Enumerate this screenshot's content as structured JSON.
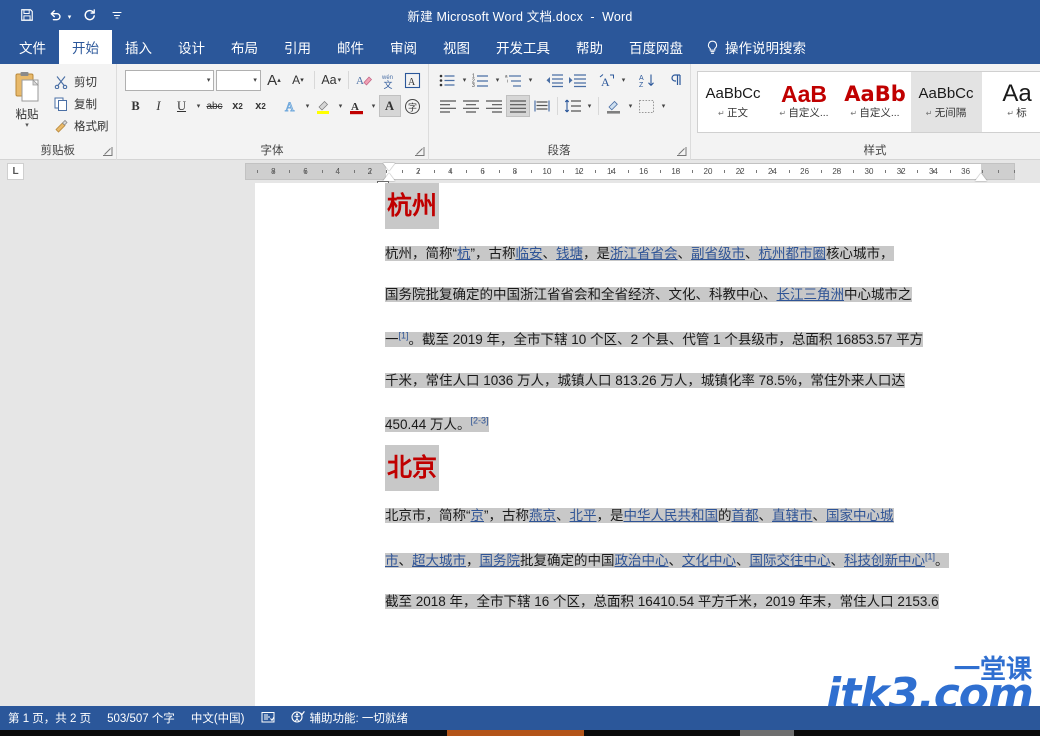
{
  "window": {
    "title": "新建 Microsoft Word 文档.docx  -  Word",
    "qat": [
      {
        "name": "save-icon",
        "label": "保存"
      },
      {
        "name": "undo-icon",
        "label": "撤消"
      },
      {
        "name": "redo-icon",
        "label": "恢复"
      },
      {
        "name": "customize-qat-icon",
        "label": "自定义快速访问工具栏"
      }
    ]
  },
  "tabs": [
    {
      "label": "文件",
      "active": false
    },
    {
      "label": "开始",
      "active": true
    },
    {
      "label": "插入",
      "active": false
    },
    {
      "label": "设计",
      "active": false
    },
    {
      "label": "布局",
      "active": false
    },
    {
      "label": "引用",
      "active": false
    },
    {
      "label": "邮件",
      "active": false
    },
    {
      "label": "审阅",
      "active": false
    },
    {
      "label": "视图",
      "active": false
    },
    {
      "label": "开发工具",
      "active": false
    },
    {
      "label": "帮助",
      "active": false
    },
    {
      "label": "百度网盘",
      "active": false
    }
  ],
  "tell_me": "操作说明搜索",
  "ribbon": {
    "clipboard": {
      "group_label": "剪贴板",
      "paste_label": "粘贴",
      "commands": [
        {
          "label": "剪切",
          "icon": "scissors-icon"
        },
        {
          "label": "复制",
          "icon": "copy-icon"
        },
        {
          "label": "格式刷",
          "icon": "format-painter-icon"
        }
      ]
    },
    "font": {
      "group_label": "字体",
      "font_name_value": "",
      "font_size_value": "",
      "row1": [
        "grow-font-icon",
        "shrink-font-icon",
        "change-case-icon",
        "clear-formatting-icon",
        "phonetic-guide-icon",
        "character-border-icon"
      ],
      "row2": [
        "bold-icon",
        "italic-icon",
        "underline-icon",
        "strikethrough-icon",
        "subscript-icon",
        "superscript-icon",
        "text-effects-icon",
        "text-highlight-icon",
        "font-color-icon",
        "character-shading-icon",
        "enclose-characters-icon"
      ],
      "labels": {
        "bold": "B",
        "italic": "I",
        "underline": "U",
        "strikethrough": "abc",
        "subscript": "x₂",
        "superscript": "x²",
        "change_case": "Aa",
        "grow": "A",
        "shrink": "A",
        "text_effects": "A",
        "font_color": "A",
        "shading": "A",
        "enclose": "字",
        "phonetic": "文"
      }
    },
    "paragraph": {
      "group_label": "段落",
      "row1": [
        "bullets-icon",
        "numbering-icon",
        "multilevel-list-icon",
        "decrease-indent-icon",
        "increase-indent-icon",
        "asian-layout-icon",
        "sort-icon",
        "show-marks-icon"
      ],
      "row2": [
        "align-left-icon",
        "align-center-icon",
        "align-right-icon",
        "justify-icon",
        "distributed-icon",
        "line-spacing-icon",
        "shading-icon",
        "borders-icon"
      ],
      "active_alignment": "justify-icon"
    },
    "styles": {
      "group_label": "样式",
      "items": [
        {
          "preview": "AaBbCc",
          "name": "正文",
          "color": "#1a1a1a",
          "size": "15px",
          "weight": "normal",
          "selected": false
        },
        {
          "preview": "AaB",
          "name": "自定义...",
          "color": "#c00000",
          "size": "23px",
          "weight": "bold",
          "selected": false
        },
        {
          "preview": "AaBb",
          "name": "自定义...",
          "color": "#c00000",
          "size": "21px",
          "weight": "bold",
          "selected": false
        },
        {
          "preview": "AaBbCc",
          "name": "无间隔",
          "color": "#1a1a1a",
          "size": "15px",
          "weight": "normal",
          "selected": true
        },
        {
          "preview": "Aa",
          "name": "标",
          "color": "#1a1a1a",
          "size": "24px",
          "weight": "normal",
          "selected": false
        }
      ]
    }
  },
  "ruler": {
    "tab_selector": "L",
    "left_ticks": [
      "8",
      "6",
      "4",
      "2"
    ],
    "ticks": [
      "2",
      "4",
      "6",
      "8",
      "10",
      "12",
      "14",
      "16",
      "18",
      "20",
      "22",
      "24",
      "26",
      "28",
      "30",
      "32",
      "34",
      "36"
    ]
  },
  "document": {
    "sections": [
      {
        "heading": "杭州",
        "lines": [
          [
            {
              "t": "杭州，简称“",
              "k": "p"
            },
            {
              "t": "杭",
              "k": "a"
            },
            {
              "t": "”，古称",
              "k": "p"
            },
            {
              "t": "临安",
              "k": "a"
            },
            {
              "t": "、",
              "k": "p"
            },
            {
              "t": "钱塘",
              "k": "a"
            },
            {
              "t": "，是",
              "k": "p"
            },
            {
              "t": "浙江省省会",
              "k": "a"
            },
            {
              "t": "、",
              "k": "p"
            },
            {
              "t": "副省级市",
              "k": "a"
            },
            {
              "t": "、",
              "k": "p"
            },
            {
              "t": "杭州都市圈",
              "k": "a"
            },
            {
              "t": "核心城市，",
              "k": "p"
            }
          ],
          [
            {
              "t": "国务院批复确定的中国浙江省省会和全省经济、文化、科教中心、",
              "k": "p"
            },
            {
              "t": "长江三角洲",
              "k": "a"
            },
            {
              "t": "中心城市之",
              "k": "p"
            }
          ],
          [
            {
              "t": "一",
              "k": "p"
            },
            {
              "t": "[1]",
              "k": "r"
            },
            {
              "t": "。截至 2019 年，全市下辖 10 个区、2 个县、代管 1 个县级市，总面积 16853.57 平方",
              "k": "p"
            }
          ],
          [
            {
              "t": "千米，常住人口 1036 万人，城镇人口 813.26 万人，城镇化率 78.5%，常住外来人口达",
              "k": "p"
            }
          ],
          [
            {
              "t": "450.44 万人。",
              "k": "p"
            },
            {
              "t": "[2-3]",
              "k": "r"
            }
          ]
        ]
      },
      {
        "heading": "北京",
        "lines": [
          [
            {
              "t": "北京市，简称“",
              "k": "p"
            },
            {
              "t": "京",
              "k": "a"
            },
            {
              "t": "”，古称",
              "k": "p"
            },
            {
              "t": "燕京",
              "k": "a"
            },
            {
              "t": "、",
              "k": "p"
            },
            {
              "t": "北平",
              "k": "a"
            },
            {
              "t": "，是",
              "k": "p"
            },
            {
              "t": "中华人民共和国",
              "k": "a"
            },
            {
              "t": "的",
              "k": "p"
            },
            {
              "t": "首都",
              "k": "a"
            },
            {
              "t": "、",
              "k": "p"
            },
            {
              "t": "直辖市",
              "k": "a"
            },
            {
              "t": "、",
              "k": "p"
            },
            {
              "t": "国家中心城",
              "k": "a"
            }
          ],
          [
            {
              "t": "市",
              "k": "a"
            },
            {
              "t": "、",
              "k": "p"
            },
            {
              "t": "超大城市",
              "k": "a"
            },
            {
              "t": "，",
              "k": "p"
            },
            {
              "t": "国务院",
              "k": "a"
            },
            {
              "t": "批复确定的中国",
              "k": "p"
            },
            {
              "t": "政治中心",
              "k": "a"
            },
            {
              "t": "、",
              "k": "p"
            },
            {
              "t": "文化中心",
              "k": "a"
            },
            {
              "t": "、",
              "k": "p"
            },
            {
              "t": "国际交往中心",
              "k": "a"
            },
            {
              "t": "、",
              "k": "p"
            },
            {
              "t": "科技创新中心",
              "k": "a"
            },
            {
              "t": "[1]",
              "k": "r"
            },
            {
              "t": "。",
              "k": "p"
            }
          ],
          [
            {
              "t": "截至 2018 年，全市下辖 16 个区，总面积 16410.54 平方千米，2019 年末，常住人口 2153.6",
              "k": "p"
            }
          ]
        ]
      }
    ]
  },
  "watermark": {
    "main": "itk3.com",
    "cn": "一堂课"
  },
  "status_bar": {
    "page": "第 1 页，共 2 页",
    "words": "503/507 个字",
    "language": "中文(中国)",
    "proofing_icon": "proofing-icon",
    "accessibility_icon": "accessibility-icon",
    "accessibility": "辅助功能: 一切就绪"
  },
  "colors": {
    "accent": "#2b579a",
    "heading": "#c00000",
    "link": "#2f5496",
    "selection": "#c8c8c8",
    "watermark": "#2f6fd0"
  }
}
